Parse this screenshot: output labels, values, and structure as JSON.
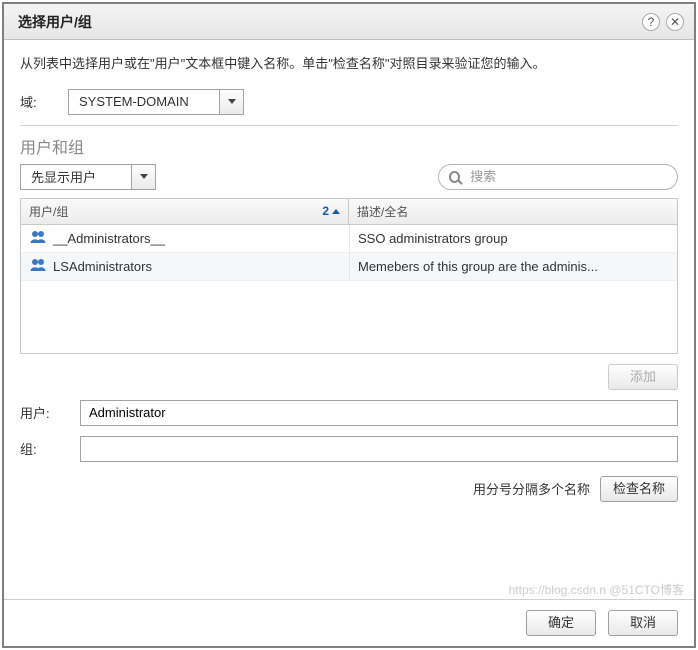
{
  "dialog": {
    "title": "选择用户/组",
    "help_icon": "?",
    "close_icon": "✕"
  },
  "instruction": "从列表中选择用户或在\"用户\"文本框中键入名称。单击\"检查名称\"对照目录来验证您的输入。",
  "domain": {
    "label": "域:",
    "value": "SYSTEM-DOMAIN"
  },
  "section_title": "用户和组",
  "filter": {
    "value": "先显示用户"
  },
  "search": {
    "placeholder": "搜索"
  },
  "table": {
    "columns": {
      "usergroup": "用户/组",
      "desc": "描述/全名"
    },
    "sort_indicator": "2",
    "rows": [
      {
        "name": "__Administrators__",
        "desc": "SSO administrators group"
      },
      {
        "name": "LSAdministrators",
        "desc": "Memebers of this group are the adminis..."
      }
    ]
  },
  "buttons": {
    "add": "添加",
    "check_names": "检查名称",
    "ok": "确定",
    "cancel": "取消"
  },
  "fields": {
    "users_label": "用户:",
    "users_value": "Administrator",
    "groups_label": "组:",
    "groups_value": ""
  },
  "hint": "用分号分隔多个名称",
  "watermark": "https://blog.csdn.n @51CTO博客"
}
